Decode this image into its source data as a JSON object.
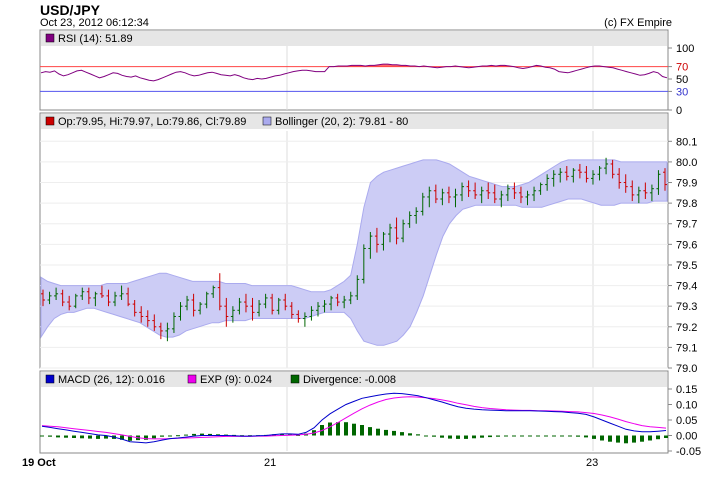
{
  "header": {
    "symbol": "USD/JPY",
    "timestamp": "Oct 23, 2012 06:12:34",
    "copyright": "(c) FX Empire"
  },
  "rsi_panel": {
    "legend": "RSI (14): 51.89",
    "legend_color": "#800080",
    "ticks": [
      "100",
      "70",
      "50",
      "30",
      "0"
    ],
    "overbought": 70,
    "oversold": 30
  },
  "price_panel": {
    "legend_ohlc": "Op:79.95, Hi:79.97, Lo:79.86, Cl:79.89",
    "legend_ohlc_color": "#cc0000",
    "legend_boll": "Bollinger (20, 2): 79.81 - 80",
    "legend_boll_color": "#aaaaee",
    "ticks": [
      "80.1",
      "80.0",
      "79.9",
      "79.8",
      "79.7",
      "79.6",
      "79.5",
      "79.4",
      "79.3",
      "79.2",
      "79.1",
      "79.0"
    ]
  },
  "macd_panel": {
    "legend_macd": "MACD (26, 12): 0.016",
    "legend_macd_color": "#0000cc",
    "legend_exp": "EXP (9): 0.024",
    "legend_exp_color": "#ee00ee",
    "legend_div": "Divergence: -0.008",
    "legend_div_color": "#006600",
    "ticks": [
      "0.15",
      "0.10",
      "0.05",
      "0.00",
      "-0.05"
    ]
  },
  "xaxis": {
    "labels": [
      "19 Oct",
      "21",
      "23"
    ]
  },
  "colors": {
    "up": "#006600",
    "down": "#cc0000",
    "band": "#ccccf5",
    "panel_bg": "#e6e6e6"
  },
  "chart_data": [
    {
      "type": "line",
      "title": "RSI (14)",
      "ylim": [
        0,
        100
      ],
      "overbought": 70,
      "oversold": 30,
      "values": [
        60,
        62,
        61,
        63,
        58,
        55,
        57,
        60,
        63,
        64,
        61,
        58,
        55,
        52,
        54,
        57,
        60,
        59,
        56,
        54,
        53,
        55,
        52,
        50,
        48,
        47,
        49,
        52,
        55,
        58,
        61,
        62,
        60,
        57,
        55,
        56,
        58,
        60,
        61,
        59,
        57,
        56,
        55,
        57,
        55,
        52,
        50,
        49,
        51,
        50,
        51,
        53,
        55,
        56,
        58,
        60,
        62,
        63,
        64,
        64,
        63,
        62,
        62,
        62,
        70,
        70,
        71,
        71,
        71,
        72,
        72,
        72,
        71,
        72,
        72,
        73,
        74,
        74,
        73,
        73,
        72,
        72,
        71,
        71,
        70,
        71,
        70,
        69,
        68,
        69,
        70,
        70,
        71,
        70,
        69,
        68,
        69,
        70,
        71,
        71,
        72,
        71,
        72,
        72,
        71,
        70,
        68,
        67,
        68,
        70,
        72,
        71,
        69,
        68,
        66,
        62,
        61,
        60,
        62,
        64,
        66,
        68,
        70,
        71,
        71,
        70,
        69,
        68,
        66,
        64,
        62,
        60,
        58,
        56,
        57,
        59,
        62,
        60,
        54,
        52
      ]
    },
    {
      "type": "bar",
      "title": "USD/JPY",
      "ylim": [
        79.0,
        80.15
      ],
      "ohlc": [
        [
          79.36,
          79.38,
          79.3,
          79.33
        ],
        [
          79.33,
          79.37,
          79.31,
          79.35
        ],
        [
          79.35,
          79.39,
          79.33,
          79.36
        ],
        [
          79.36,
          79.38,
          79.3,
          79.32
        ],
        [
          79.32,
          79.35,
          79.28,
          79.3
        ],
        [
          79.3,
          79.36,
          79.29,
          79.35
        ],
        [
          79.35,
          79.39,
          79.33,
          79.37
        ],
        [
          79.37,
          79.39,
          79.31,
          79.34
        ],
        [
          79.34,
          79.37,
          79.3,
          79.36
        ],
        [
          79.36,
          79.4,
          79.34,
          79.35
        ],
        [
          79.35,
          79.38,
          79.3,
          79.32
        ],
        [
          79.32,
          79.37,
          79.3,
          79.35
        ],
        [
          79.35,
          79.4,
          79.33,
          79.36
        ],
        [
          79.36,
          79.39,
          79.3,
          79.31
        ],
        [
          79.31,
          79.33,
          79.25,
          79.27
        ],
        [
          79.27,
          79.3,
          79.22,
          79.25
        ],
        [
          79.25,
          79.28,
          79.2,
          79.23
        ],
        [
          79.23,
          79.26,
          79.18,
          79.2
        ],
        [
          79.2,
          79.22,
          79.14,
          79.18
        ],
        [
          79.18,
          79.22,
          79.13,
          79.19
        ],
        [
          79.19,
          79.27,
          79.17,
          79.25
        ],
        [
          79.25,
          79.32,
          79.23,
          79.3
        ],
        [
          79.3,
          79.35,
          79.28,
          79.33
        ],
        [
          79.33,
          79.36,
          79.25,
          79.28
        ],
        [
          79.28,
          79.32,
          79.26,
          79.31
        ],
        [
          79.31,
          79.37,
          79.29,
          79.36
        ],
        [
          79.36,
          79.4,
          79.34,
          79.39
        ],
        [
          79.39,
          79.46,
          79.28,
          79.3
        ],
        [
          79.3,
          79.34,
          79.2,
          79.25
        ],
        [
          79.25,
          79.3,
          79.22,
          79.28
        ],
        [
          79.28,
          79.34,
          79.26,
          79.32
        ],
        [
          79.32,
          79.36,
          79.27,
          79.3
        ],
        [
          79.3,
          79.34,
          79.23,
          79.27
        ],
        [
          79.27,
          79.33,
          79.25,
          79.31
        ],
        [
          79.31,
          79.36,
          79.29,
          79.34
        ],
        [
          79.34,
          79.36,
          79.26,
          79.28
        ],
        [
          79.28,
          79.34,
          79.26,
          79.33
        ],
        [
          79.33,
          79.36,
          79.28,
          79.3
        ],
        [
          79.3,
          79.32,
          79.24,
          79.26
        ],
        [
          79.26,
          79.28,
          79.22,
          79.24
        ],
        [
          79.24,
          79.27,
          79.2,
          79.25
        ],
        [
          79.25,
          79.3,
          79.23,
          79.28
        ],
        [
          79.28,
          79.32,
          79.25,
          79.3
        ],
        [
          79.3,
          79.33,
          79.27,
          79.31
        ],
        [
          79.31,
          79.35,
          79.28,
          79.34
        ],
        [
          79.34,
          79.36,
          79.3,
          79.32
        ],
        [
          79.32,
          79.35,
          79.29,
          79.33
        ],
        [
          79.33,
          79.37,
          79.31,
          79.35
        ],
        [
          79.35,
          79.45,
          79.33,
          79.43
        ],
        [
          79.43,
          79.6,
          79.41,
          79.58
        ],
        [
          79.58,
          79.66,
          79.53,
          79.64
        ],
        [
          79.64,
          79.68,
          79.56,
          79.6
        ],
        [
          79.6,
          79.66,
          79.57,
          79.65
        ],
        [
          79.65,
          79.7,
          79.61,
          79.68
        ],
        [
          79.68,
          79.73,
          79.6,
          79.63
        ],
        [
          79.63,
          79.72,
          79.61,
          79.7
        ],
        [
          79.7,
          79.76,
          79.68,
          79.74
        ],
        [
          79.74,
          79.78,
          79.7,
          79.76
        ],
        [
          79.76,
          79.85,
          79.74,
          79.83
        ],
        [
          79.83,
          79.88,
          79.78,
          79.86
        ],
        [
          79.86,
          79.89,
          79.8,
          79.82
        ],
        [
          79.82,
          79.87,
          79.79,
          79.85
        ],
        [
          79.85,
          79.88,
          79.8,
          79.83
        ],
        [
          79.83,
          79.87,
          79.78,
          79.84
        ],
        [
          79.84,
          79.9,
          79.81,
          79.88
        ],
        [
          79.88,
          79.91,
          79.83,
          79.86
        ],
        [
          79.86,
          79.9,
          79.82,
          79.84
        ],
        [
          79.84,
          79.88,
          79.8,
          79.86
        ],
        [
          79.86,
          79.9,
          79.82,
          79.85
        ],
        [
          79.85,
          79.89,
          79.8,
          79.82
        ],
        [
          79.82,
          79.86,
          79.78,
          79.84
        ],
        [
          79.84,
          79.89,
          79.81,
          79.87
        ],
        [
          79.87,
          79.9,
          79.82,
          79.85
        ],
        [
          79.85,
          79.88,
          79.8,
          79.83
        ],
        [
          79.83,
          79.86,
          79.79,
          79.84
        ],
        [
          79.84,
          79.88,
          79.81,
          79.86
        ],
        [
          79.86,
          79.9,
          79.84,
          79.89
        ],
        [
          79.89,
          79.94,
          79.86,
          79.92
        ],
        [
          79.92,
          79.96,
          79.88,
          79.94
        ],
        [
          79.94,
          79.97,
          79.9,
          79.95
        ],
        [
          79.95,
          79.98,
          79.91,
          79.93
        ],
        [
          79.93,
          79.97,
          79.9,
          79.96
        ],
        [
          79.96,
          79.99,
          79.92,
          79.95
        ],
        [
          79.95,
          79.98,
          79.9,
          79.92
        ],
        [
          79.92,
          79.96,
          79.89,
          79.94
        ],
        [
          79.94,
          79.98,
          79.91,
          79.97
        ],
        [
          79.97,
          80.02,
          79.94,
          79.99
        ],
        [
          79.99,
          80.01,
          79.92,
          79.94
        ],
        [
          79.94,
          79.97,
          79.87,
          79.9
        ],
        [
          79.9,
          79.94,
          79.85,
          79.88
        ],
        [
          79.88,
          79.91,
          79.81,
          79.84
        ],
        [
          79.84,
          79.88,
          79.8,
          79.86
        ],
        [
          79.86,
          79.9,
          79.82,
          79.85
        ],
        [
          79.85,
          79.89,
          79.81,
          79.87
        ],
        [
          79.87,
          79.96,
          79.84,
          79.94
        ],
        [
          79.95,
          79.97,
          79.86,
          79.89
        ]
      ],
      "bollinger": {
        "upper": [
          79.44,
          79.42,
          79.41,
          79.4,
          79.4,
          79.4,
          79.4,
          79.4,
          79.4,
          79.4,
          79.41,
          79.41,
          79.41,
          79.41,
          79.42,
          79.43,
          79.44,
          79.45,
          79.46,
          79.46,
          79.45,
          79.44,
          79.43,
          79.42,
          79.42,
          79.42,
          79.42,
          79.42,
          79.41,
          79.41,
          79.41,
          79.41,
          79.4,
          79.4,
          79.4,
          79.4,
          79.4,
          79.4,
          79.4,
          79.39,
          79.38,
          79.37,
          79.37,
          79.37,
          79.38,
          79.4,
          79.42,
          79.45,
          79.6,
          79.78,
          79.9,
          79.93,
          79.95,
          79.96,
          79.97,
          79.98,
          79.99,
          80.0,
          80.01,
          80.01,
          80.01,
          80.0,
          79.99,
          79.97,
          79.95,
          79.93,
          79.92,
          79.91,
          79.9,
          79.89,
          79.88,
          79.88,
          79.88,
          79.89,
          79.9,
          79.92,
          79.94,
          79.96,
          79.98,
          80.0,
          80.01,
          80.01,
          80.01,
          80.01,
          80.01,
          80.01,
          80.01,
          80.01,
          80.0,
          80.0,
          80.0,
          80.0,
          80.0,
          80.0,
          80.0,
          80.0
        ],
        "lower": [
          79.15,
          79.2,
          79.24,
          79.26,
          79.27,
          79.27,
          79.28,
          79.29,
          79.29,
          79.28,
          79.27,
          79.26,
          79.25,
          79.24,
          79.23,
          79.22,
          79.2,
          79.18,
          79.16,
          79.15,
          79.15,
          79.16,
          79.18,
          79.19,
          79.2,
          79.21,
          79.22,
          79.22,
          79.23,
          79.23,
          79.23,
          79.23,
          79.24,
          79.24,
          79.24,
          79.24,
          79.24,
          79.24,
          79.24,
          79.24,
          79.24,
          79.25,
          79.26,
          79.27,
          79.27,
          79.27,
          79.27,
          79.24,
          79.18,
          79.13,
          79.12,
          79.11,
          79.11,
          79.12,
          79.13,
          79.16,
          79.2,
          79.27,
          79.35,
          79.45,
          79.55,
          79.64,
          79.7,
          79.74,
          79.77,
          79.78,
          79.79,
          79.79,
          79.79,
          79.79,
          79.79,
          79.79,
          79.79,
          79.78,
          79.78,
          79.78,
          79.78,
          79.79,
          79.8,
          79.81,
          79.82,
          79.82,
          79.82,
          79.81,
          79.8,
          79.79,
          79.79,
          79.79,
          79.8,
          79.8,
          79.8,
          79.8,
          79.8,
          79.81,
          79.81,
          79.81
        ]
      }
    },
    {
      "type": "line",
      "title": "MACD (26, 12)",
      "ylim": [
        -0.05,
        0.15
      ],
      "macd": [
        0.03,
        0.026,
        0.022,
        0.018,
        0.014,
        0.01,
        0.006,
        0.002,
        0.0,
        -0.005,
        -0.012,
        -0.02,
        -0.022,
        -0.024,
        -0.02,
        -0.015,
        -0.01,
        -0.008,
        -0.005,
        -0.002,
        0.0,
        0.0,
        0.0,
        0.0,
        -0.001,
        -0.002,
        -0.002,
        -0.001,
        0.0,
        0.003,
        0.005,
        0.005,
        0.004,
        0.01,
        0.025,
        0.05,
        0.07,
        0.085,
        0.1,
        0.11,
        0.12,
        0.125,
        0.13,
        0.134,
        0.136,
        0.135,
        0.132,
        0.128,
        0.122,
        0.115,
        0.108,
        0.1,
        0.093,
        0.088,
        0.085,
        0.083,
        0.082,
        0.081,
        0.08,
        0.08,
        0.08,
        0.08,
        0.079,
        0.078,
        0.077,
        0.076,
        0.074,
        0.072,
        0.068,
        0.06,
        0.05,
        0.04,
        0.03,
        0.02,
        0.015,
        0.012,
        0.012,
        0.014,
        0.016
      ],
      "exp": [
        0.032,
        0.03,
        0.028,
        0.025,
        0.022,
        0.019,
        0.016,
        0.013,
        0.01,
        0.006,
        0.002,
        -0.003,
        -0.007,
        -0.01,
        -0.011,
        -0.011,
        -0.01,
        -0.009,
        -0.008,
        -0.007,
        -0.006,
        -0.005,
        -0.004,
        -0.003,
        -0.003,
        -0.003,
        -0.003,
        -0.002,
        -0.002,
        -0.001,
        0.0,
        0.001,
        0.002,
        0.004,
        0.008,
        0.016,
        0.028,
        0.042,
        0.057,
        0.072,
        0.086,
        0.098,
        0.108,
        0.116,
        0.121,
        0.124,
        0.125,
        0.124,
        0.122,
        0.119,
        0.115,
        0.11,
        0.104,
        0.099,
        0.094,
        0.09,
        0.087,
        0.085,
        0.083,
        0.082,
        0.081,
        0.081,
        0.08,
        0.08,
        0.079,
        0.078,
        0.077,
        0.076,
        0.074,
        0.071,
        0.066,
        0.06,
        0.053,
        0.045,
        0.038,
        0.032,
        0.028,
        0.026,
        0.024
      ],
      "divergence": [
        -0.002,
        -0.004,
        -0.006,
        -0.007,
        -0.008,
        -0.009,
        -0.01,
        -0.011,
        -0.01,
        -0.011,
        -0.014,
        -0.017,
        -0.015,
        -0.014,
        -0.009,
        -0.004,
        0.0,
        0.001,
        0.003,
        0.005,
        0.006,
        0.005,
        0.004,
        0.003,
        0.002,
        0.001,
        0.001,
        0.001,
        0.002,
        0.004,
        0.005,
        0.004,
        0.002,
        0.006,
        0.017,
        0.034,
        0.042,
        0.043,
        0.043,
        0.038,
        0.034,
        0.027,
        0.022,
        0.018,
        0.015,
        0.011,
        0.007,
        0.004,
        0.0,
        -0.004,
        -0.007,
        -0.01,
        -0.011,
        -0.011,
        -0.009,
        -0.007,
        -0.005,
        -0.004,
        -0.003,
        -0.002,
        -0.001,
        -0.001,
        -0.001,
        -0.002,
        -0.002,
        -0.002,
        -0.003,
        -0.004,
        -0.006,
        -0.011,
        -0.016,
        -0.02,
        -0.023,
        -0.025,
        -0.023,
        -0.02,
        -0.016,
        -0.012,
        -0.008
      ]
    }
  ]
}
